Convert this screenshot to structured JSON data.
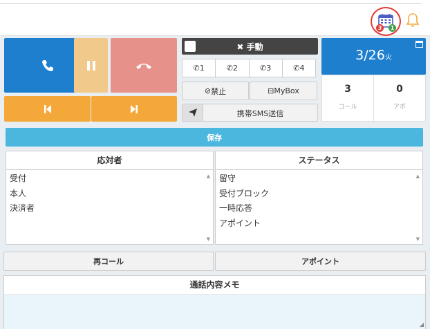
{
  "topbar": {
    "calendar_badge_left": "3",
    "calendar_badge_right": "1"
  },
  "controls": {
    "manual_label": "手動"
  },
  "lines": [
    "1",
    "2",
    "3",
    "4"
  ],
  "buttons": {
    "ban": "禁止",
    "mybox": "MyBox",
    "sms": "携帯SMS送信",
    "save": "保存",
    "recall": "再コール",
    "appointment": "アポイント"
  },
  "date": {
    "value": "3/26",
    "weekday": "火"
  },
  "stats": {
    "calls_value": "3",
    "calls_label": "コール",
    "appo_value": "0",
    "appo_label": "アポ"
  },
  "responder": {
    "header": "応対者",
    "items": [
      "受付",
      "本人",
      "決済者"
    ]
  },
  "status": {
    "header": "ステータス",
    "items": [
      "留守",
      "受付ブロック",
      "一時応答",
      "アポイント"
    ]
  },
  "memo": {
    "header": "通話内容メモ"
  },
  "colors": {
    "call_blue": "#1f7fcf",
    "hold": "#f1c98a",
    "hangup": "#e7918b",
    "skip": "#f5a83a",
    "save": "#4bb6de",
    "highlight_ring": "#e53935"
  }
}
